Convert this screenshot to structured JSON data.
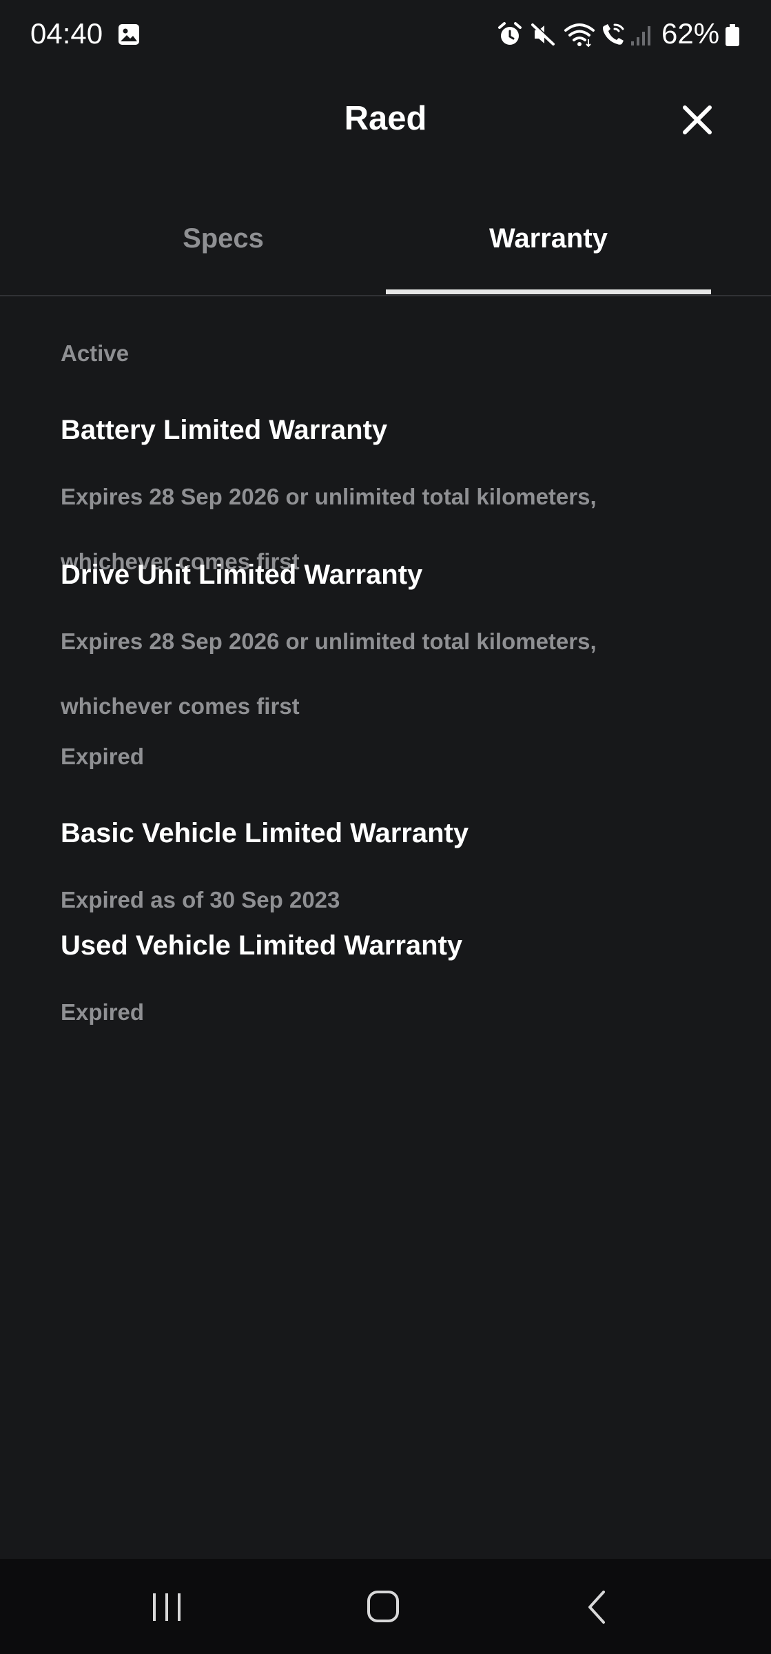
{
  "status_bar": {
    "time": "04:40",
    "battery": "62%",
    "icons": [
      "gallery-icon",
      "alarm-icon",
      "mute-icon",
      "wifi-icon",
      "wifi-calling-icon",
      "signal-icon",
      "battery-icon"
    ]
  },
  "header": {
    "title": "Raed",
    "close_icon": "close-icon"
  },
  "tabs": [
    {
      "label": "Specs",
      "active": false
    },
    {
      "label": "Warranty",
      "active": true
    }
  ],
  "sections": {
    "active": {
      "label": "Active",
      "items": [
        {
          "title": "Battery Limited Warranty",
          "desc_line1": "Expires 28 Sep 2026 or unlimited total kilometers,",
          "desc_line2": "whichever comes first"
        },
        {
          "title": "Drive Unit Limited Warranty",
          "desc_line1": "Expires 28 Sep 2026 or unlimited total kilometers,",
          "desc_line2": "whichever comes first"
        }
      ]
    },
    "expired": {
      "label": "Expired",
      "items": [
        {
          "title": "Basic Vehicle Limited Warranty",
          "desc_line1": "Expired as of 30 Sep 2023"
        },
        {
          "title": "Used Vehicle Limited Warranty",
          "desc_line1": "Expired"
        }
      ]
    }
  },
  "nav_bar": {
    "buttons": [
      "recents-icon",
      "home-icon",
      "back-icon"
    ]
  },
  "colors": {
    "background": "#17181a",
    "text_primary": "#ffffff",
    "text_secondary": "#8f9093",
    "nav_background": "#0c0c0d"
  }
}
